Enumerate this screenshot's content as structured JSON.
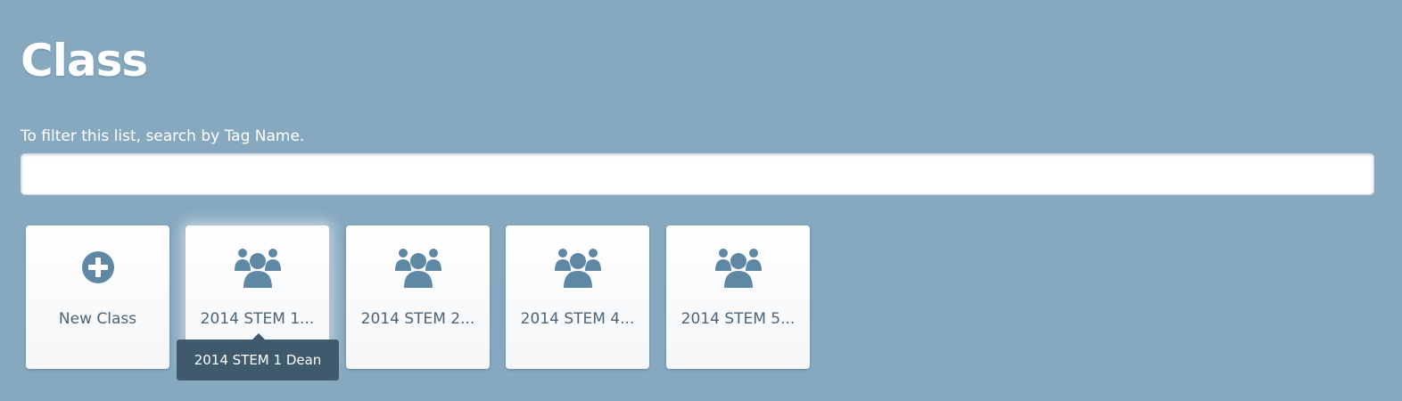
{
  "page": {
    "title": "Class"
  },
  "filter": {
    "hint": "To filter this list, search by Tag Name.",
    "value": "",
    "placeholder": ""
  },
  "tiles": [
    {
      "label": "New Class",
      "icon": "plus-circle-icon"
    },
    {
      "label": "2014 STEM 1...",
      "icon": "group-icon"
    },
    {
      "label": "2014 STEM 2...",
      "icon": "group-icon"
    },
    {
      "label": "2014 STEM 4...",
      "icon": "group-icon"
    },
    {
      "label": "2014 STEM 5...",
      "icon": "group-icon"
    }
  ],
  "tooltip": {
    "text": "2014 STEM 1 Dean"
  },
  "colors": {
    "background": "#87a9c0",
    "icon": "#5f88a5",
    "tile_text": "#4d6477",
    "tooltip_bg": "#3f5a6d"
  }
}
